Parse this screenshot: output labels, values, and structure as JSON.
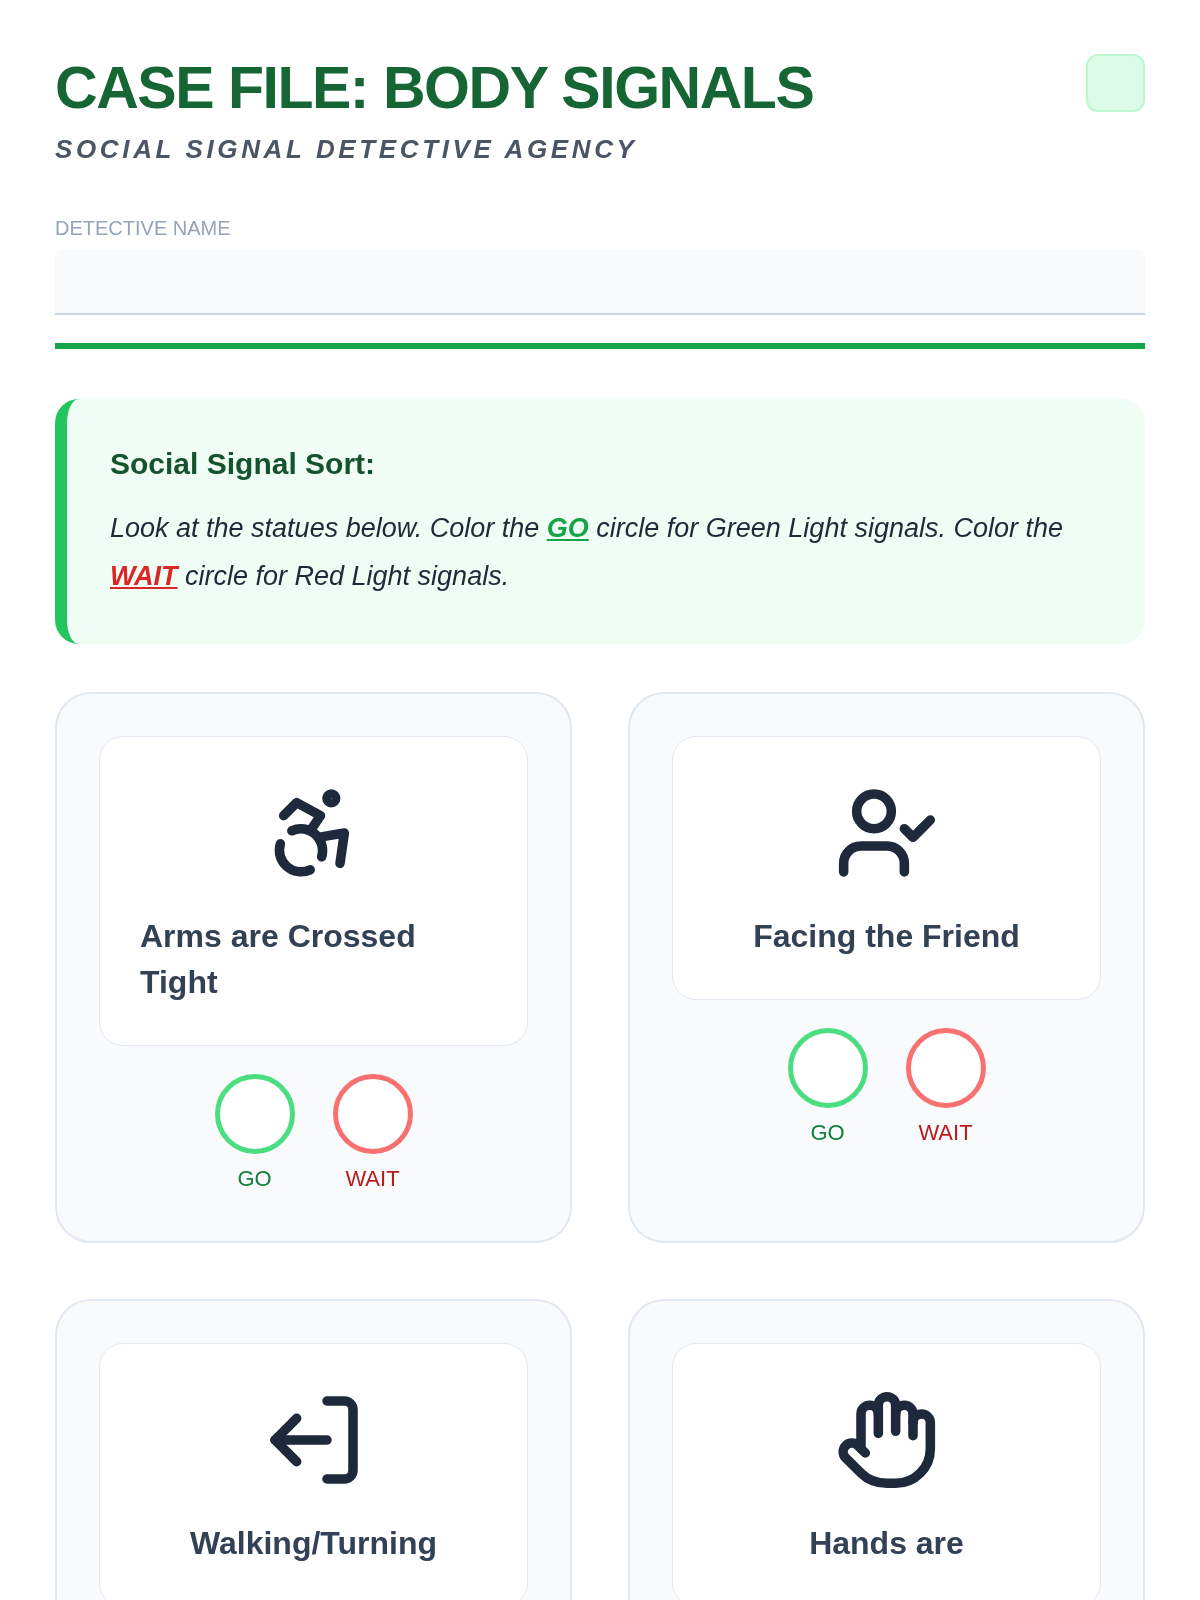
{
  "header": {
    "title": "CASE FILE: BODY SIGNALS",
    "subtitle": "SOCIAL SIGNAL DETECTIVE AGENCY"
  },
  "name_field": {
    "label": "DETECTIVE NAME"
  },
  "instructions": {
    "heading": "Social Signal Sort:",
    "parts": [
      {
        "kind": "text",
        "text": "Look at the statues below. Color the "
      },
      {
        "kind": "go",
        "text": "GO"
      },
      {
        "kind": "text",
        "text": " circle for Green Light signals. Color the "
      },
      {
        "kind": "wait",
        "text": "WAIT"
      },
      {
        "kind": "text",
        "text": " circle for Red Light signals."
      }
    ]
  },
  "cards": [
    {
      "kind": "wheelchair",
      "label": "Arms are Crossed Tight",
      "options": [
        {
          "kind": "go",
          "text": "GO"
        },
        {
          "kind": "wait",
          "text": "WAIT"
        }
      ]
    },
    {
      "kind": "person",
      "label": "Facing the Friend",
      "options": [
        {
          "kind": "go",
          "text": "GO"
        },
        {
          "kind": "wait",
          "text": "WAIT"
        }
      ]
    },
    {
      "kind": "exit",
      "label": "Walking/Turning"
    },
    {
      "kind": "hand",
      "label": "Hands are"
    }
  ]
}
